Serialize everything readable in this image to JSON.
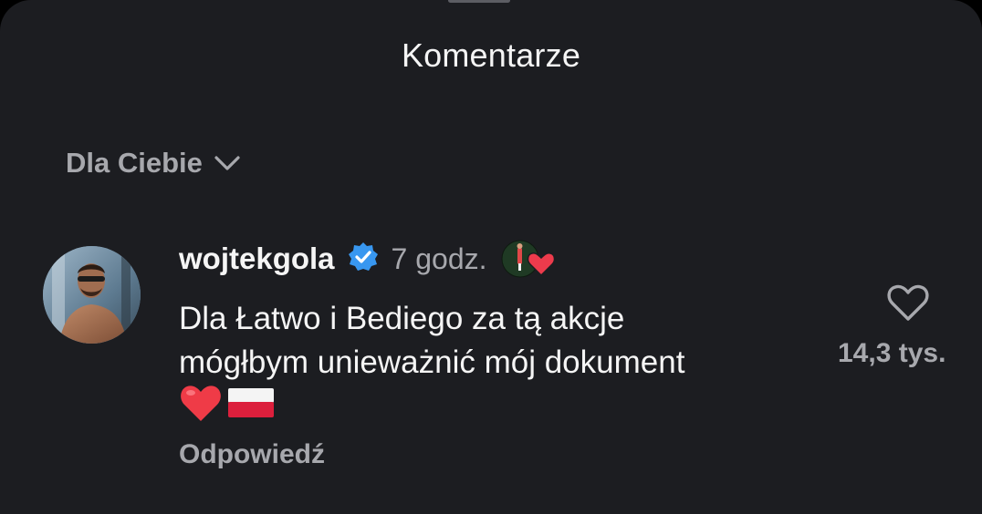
{
  "sheet": {
    "title": "Komentarze"
  },
  "filter": {
    "label": "Dla Ciebie",
    "icon": "chevron-down-icon"
  },
  "comment": {
    "username": "wojtekgola",
    "verified_icon": "verified-badge-icon",
    "time": "7 godz.",
    "creator_like_icon": "creator-liked-heart-icon",
    "text_line1": "Dla Łatwo i Bediego za tą akcje",
    "text_line2": "mógłbym unieważnić mój dokument",
    "emojis": [
      "red-heart-emoji",
      "poland-flag-emoji"
    ],
    "reply_label": "Odpowiedź",
    "like_icon": "heart-outline-icon",
    "like_count": "14,3 tys."
  },
  "colors": {
    "background": "#1c1d21",
    "text_primary": "#f5f5f5",
    "text_secondary": "#a7a8ad",
    "verified_blue": "#3897f0",
    "heart_red": "#ed3b4c"
  }
}
